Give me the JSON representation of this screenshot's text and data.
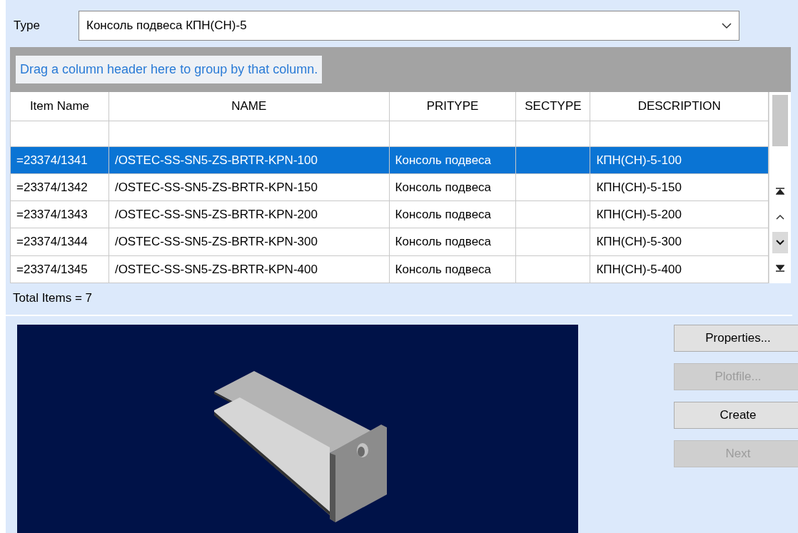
{
  "type_field": {
    "label": "Type",
    "value": "Консоль подвеса КПН(СН)-5"
  },
  "grid": {
    "group_hint": "Drag a column header here to group by that column.",
    "columns": [
      "Item Name",
      "NAME",
      "PRITYPE",
      "SECTYPE",
      "DESCRIPTION"
    ],
    "rows": [
      {
        "cells": [
          "=23374/1341",
          "/OSTEC-SS-SN5-ZS-BRTR-KPN-100",
          "Консоль подвеса",
          "",
          "КПН(СН)-5-100"
        ],
        "selected": true
      },
      {
        "cells": [
          "=23374/1342",
          "/OSTEC-SS-SN5-ZS-BRTR-KPN-150",
          "Консоль подвеса",
          "",
          "КПН(СН)-5-150"
        ],
        "selected": false
      },
      {
        "cells": [
          "=23374/1343",
          "/OSTEC-SS-SN5-ZS-BRTR-KPN-200",
          "Консоль подвеса",
          "",
          "КПН(СН)-5-200"
        ],
        "selected": false
      },
      {
        "cells": [
          "=23374/1344",
          "/OSTEC-SS-SN5-ZS-BRTR-KPN-300",
          "Консоль подвеса",
          "",
          "КПН(СН)-5-300"
        ],
        "selected": false
      },
      {
        "cells": [
          "=23374/1345",
          "/OSTEC-SS-SN5-ZS-BRTR-KPN-400",
          "Консоль подвеса",
          "",
          "КПН(СН)-5-400"
        ],
        "selected": false
      }
    ],
    "total": "Total Items = 7"
  },
  "buttons": [
    {
      "label": "Properties...",
      "disabled": false
    },
    {
      "label": "Plotfile...",
      "disabled": true
    },
    {
      "label": "Create",
      "disabled": false
    },
    {
      "label": "Next",
      "disabled": true
    }
  ]
}
